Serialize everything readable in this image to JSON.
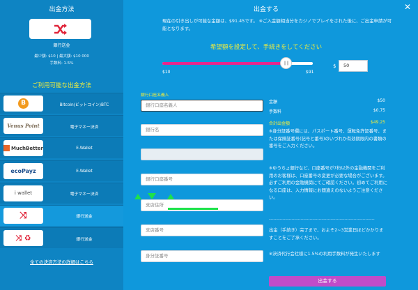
{
  "left": {
    "title": "出金方法",
    "selected": {
      "name": "銀行送金",
      "limits": "最少額: $10 | 最大額: $10 000",
      "fee": "手数料: 1.5%"
    },
    "available_title": "ご利用可能な出金方法",
    "methods": [
      {
        "logo": "B",
        "label": "Bitcoin(ビットコイン)BTC"
      },
      {
        "logo": "Venus Point",
        "label": "電子マネー決済"
      },
      {
        "logo": "MuchBetter",
        "label": "E-Wallet"
      },
      {
        "logo": "ecoPayz",
        "label": "E-Wallet"
      },
      {
        "logo": "i wallet",
        "label": "電子マネー決済"
      },
      {
        "logo": "⤨",
        "label": "銀行送金"
      },
      {
        "logo": "⤨ ♻",
        "label": "銀行送金"
      }
    ],
    "all_link": "全ての決済方法の詳細はこちら"
  },
  "main": {
    "title": "出金する",
    "info": "現在の引き出しが可能な金額は、$91.45です。 ※ご入金額相当分をカジノでプレイをされた後に、ご出金申請が可能となります。",
    "range_title": "希望額を設定して、手続きをしてください",
    "slider_min": "$10",
    "slider_max": "$91",
    "slider_fraction": 0.8,
    "dollar": "$",
    "amount": "50"
  },
  "form": {
    "holder_label": "銀行口座名義人",
    "holder_placeholder": "銀行口座名義人",
    "bank_placeholder": "銀行名",
    "code_placeholder": "銀行コード",
    "account_placeholder": "銀行口座番号",
    "branch_addr_placeholder": "支店住所",
    "branch_num_placeholder": "支店番号",
    "id_placeholder": "身分証番号"
  },
  "summary": {
    "amount_label": "金額",
    "amount_value": "$50",
    "fee_label": "手数料",
    "fee_value": "$0.75",
    "total_label": "合計出金額",
    "total_value": "$49.25"
  },
  "notes": {
    "id_note": "※身分証番号欄には、パスポート番号、運転免許証番号、または保険証番号(記号と番号)のいづれか有効期限内の書類の番号をご入力ください。",
    "yucho_note": "※ゆうちょ銀行など、口座番号が7桁以外の金融機関をご利用のお客様は、口座番号の変更が必要な場合がございます。必ずご利用の金融機関にてご確認ください。初めてご利用になる口座は、入力情報にお間違えのないようご注意ください。",
    "divider": "----------------------------------------------------------------------",
    "timing_note": "出金（手続き）完了まで、およそ2~3営業日ほどかかりますことをご了承ください。",
    "fee_note": "※決済代行会社様に1.5%の利用手数料が発生いたします"
  },
  "submit_label": "出金する",
  "colors": {
    "accent_yellow": "#f3ee3b",
    "slider_pink": "#e8278d",
    "submit_purple": "#c04cc9",
    "annotation_green": "#1de24a"
  }
}
